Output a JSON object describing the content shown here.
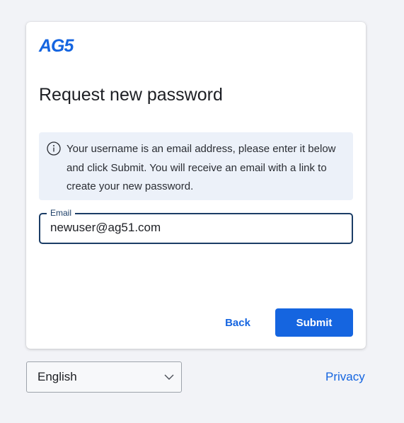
{
  "brand": {
    "logo_text": "AG5",
    "accent_color": "#1565e0"
  },
  "form": {
    "title": "Request new password",
    "info": {
      "icon": "info-icon",
      "text": "Your username is an email address, please enter it below and click Submit. You will receive an email with a link to create your new password."
    },
    "email": {
      "label": "Email",
      "value": "newuser@ag51.com"
    },
    "back_label": "Back",
    "submit_label": "Submit"
  },
  "footer": {
    "language": {
      "selected": "English",
      "icon": "chevron-down-icon"
    },
    "privacy_label": "Privacy"
  }
}
